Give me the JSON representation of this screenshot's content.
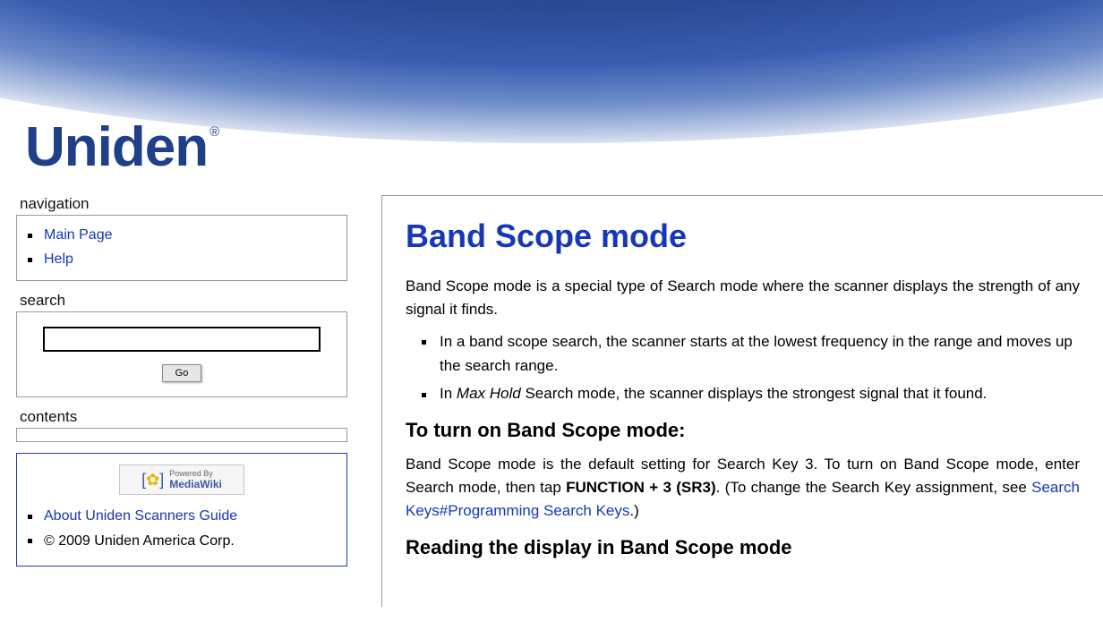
{
  "logo": {
    "text": "Uniden",
    "reg": "®"
  },
  "sidebar": {
    "nav_title": "navigation",
    "nav_items": [
      "Main Page",
      "Help"
    ],
    "search_title": "search",
    "search_value": "",
    "go_label": "Go",
    "contents_title": "contents",
    "mw_badge": {
      "line1": "Powered By",
      "line2": "MediaWiki"
    },
    "footer_items": [
      {
        "text": "About Uniden Scanners Guide",
        "link": true
      },
      {
        "text": "© 2009 Uniden America Corp.",
        "link": false
      }
    ]
  },
  "article": {
    "title": "Band Scope mode",
    "intro": "Band Scope mode is a special type of Search mode where the scanner displays the strength of any signal it finds.",
    "bullets": {
      "b1": "In a band scope search, the scanner starts at the lowest frequency in the range and moves up the search range.",
      "b2_pre": "In ",
      "b2_em": "Max Hold",
      "b2_post": " Search mode, the scanner displays the strongest signal that it found."
    },
    "h2a": "To turn on Band Scope mode:",
    "para1_pre": "Band Scope mode is the default setting for Search Key 3. To turn on Band Scope mode, enter Search mode, then tap ",
    "para1_bold": "FUNCTION + 3 (SR3)",
    "para1_mid": ". (To change the Search Key assignment, see ",
    "para1_link": "Search Keys#Programming Search Keys",
    "para1_end": ".)",
    "h2b": "Reading the display in Band Scope mode"
  }
}
